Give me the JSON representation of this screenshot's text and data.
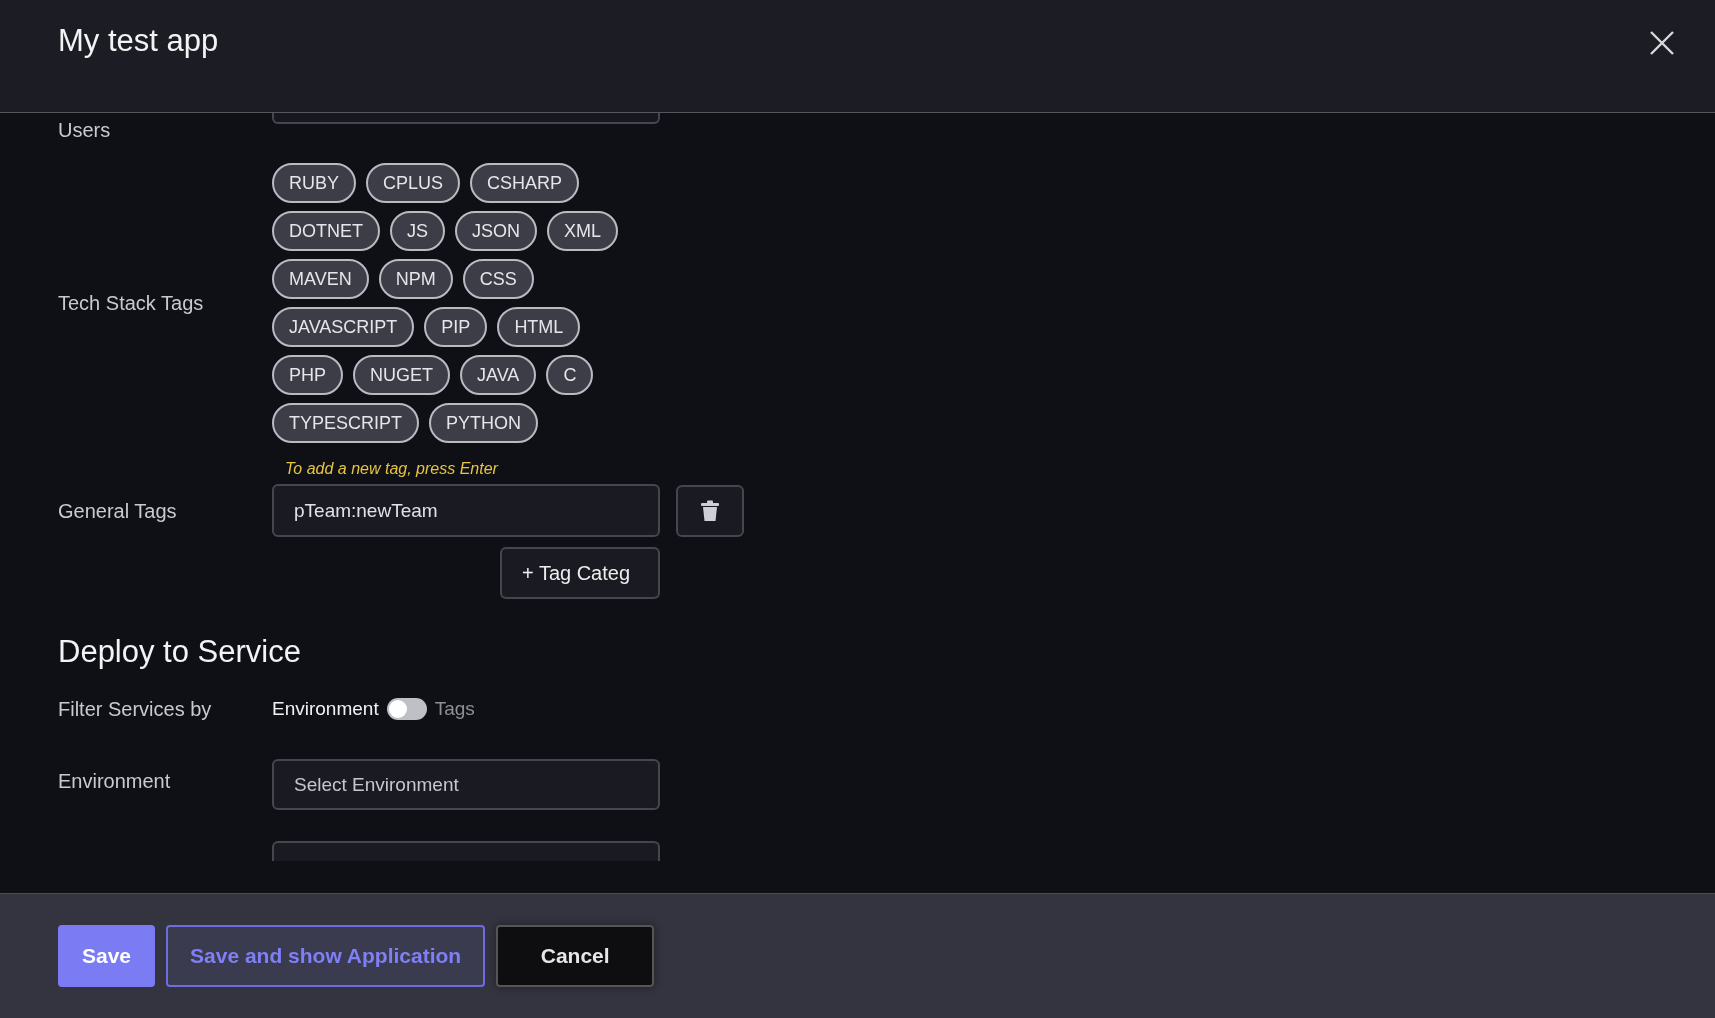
{
  "dialog": {
    "title": "My test app"
  },
  "users": {
    "label": "Users"
  },
  "tech_stack": {
    "label": "Tech Stack Tags",
    "rows": [
      [
        "RUBY",
        "CPLUS",
        "CSHARP"
      ],
      [
        "DOTNET",
        "JS",
        "JSON",
        "XML"
      ],
      [
        "MAVEN",
        "NPM",
        "CSS"
      ],
      [
        "JAVASCRIPT",
        "PIP",
        "HTML"
      ],
      [
        "PHP",
        "NUGET",
        "JAVA",
        "C"
      ],
      [
        "TYPESCRIPT",
        "PYTHON"
      ]
    ]
  },
  "general_tags": {
    "label": "General Tags",
    "hint": "To add a new tag, press Enter",
    "value": "pTeam:newTeam",
    "add_button": "+ Tag Categ"
  },
  "deploy": {
    "heading": "Deploy to Service",
    "filter": {
      "label": "Filter Services by",
      "left": "Environment",
      "right": "Tags",
      "on": false
    },
    "environment": {
      "label": "Environment",
      "placeholder": "Select Environment"
    }
  },
  "footer": {
    "buttons": [
      {
        "label": "Save",
        "kind": "primary"
      },
      {
        "label": "Save and show Application",
        "kind": "outline"
      },
      {
        "label": "Cancel",
        "kind": "dark"
      }
    ]
  }
}
